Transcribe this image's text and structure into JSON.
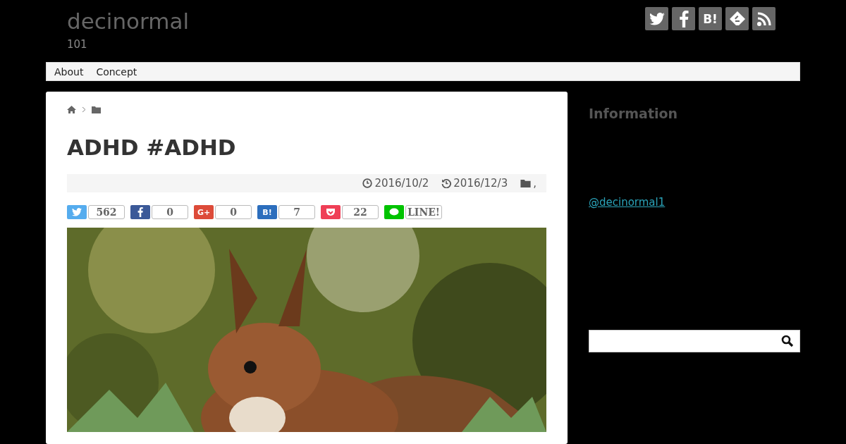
{
  "site": {
    "title": "decinormal",
    "subtitle": "101"
  },
  "header_icons": [
    {
      "kind": "twitter"
    },
    {
      "kind": "facebook"
    },
    {
      "kind": "hatena",
      "label": "B!"
    },
    {
      "kind": "feedly"
    },
    {
      "kind": "rss"
    }
  ],
  "nav": {
    "items": [
      "About",
      "Concept"
    ]
  },
  "article": {
    "title": "ADHD #ADHD",
    "published": "2016/10/2",
    "updated": "2016/12/3",
    "category_separator": ",",
    "share": [
      {
        "kind": "twitter",
        "color": "#55acee",
        "count": "562"
      },
      {
        "kind": "facebook",
        "color": "#3b5998",
        "count": "0"
      },
      {
        "kind": "googleplus",
        "color": "#dd4b39",
        "label": "G+",
        "count": "0"
      },
      {
        "kind": "hatena",
        "color": "#2c6ebd",
        "label": "B!",
        "count": "7"
      },
      {
        "kind": "pocket",
        "color": "#ef3f56",
        "count": "22"
      },
      {
        "kind": "line",
        "color": "#00c300",
        "count": "LINE!"
      }
    ]
  },
  "sidebar": {
    "heading": "Information",
    "link": "@decinormal1"
  }
}
